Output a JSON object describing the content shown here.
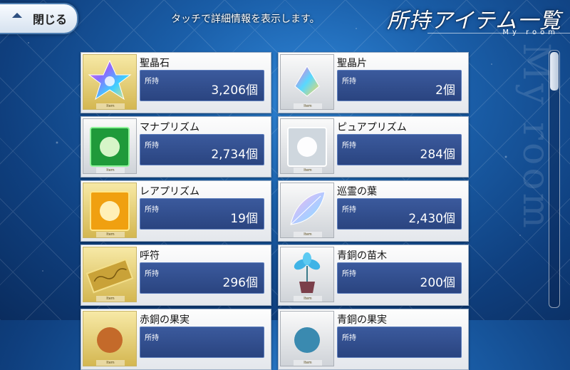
{
  "header": {
    "close_label": "閉じる",
    "hint": "タッチで詳細情報を表示します。",
    "title": "所持アイテム一覧",
    "subtitle": "My room"
  },
  "side_text": "My room",
  "owned_label": "所持",
  "item_tag": "Item",
  "items": [
    {
      "name": "聖晶石",
      "count": "3,206個",
      "icon": "saint-quartz-icon",
      "frame": "gold"
    },
    {
      "name": "聖晶片",
      "count": "2個",
      "icon": "quartz-fragment-icon",
      "frame": "silver"
    },
    {
      "name": "マナプリズム",
      "count": "2,734個",
      "icon": "mana-prism-icon",
      "frame": "silver"
    },
    {
      "name": "ピュアプリズム",
      "count": "284個",
      "icon": "pure-prism-icon",
      "frame": "silver"
    },
    {
      "name": "レアプリズム",
      "count": "19個",
      "icon": "rare-prism-icon",
      "frame": "gold"
    },
    {
      "name": "巡霊の葉",
      "count": "2,430個",
      "icon": "spirit-leaf-icon",
      "frame": "silver"
    },
    {
      "name": "呼符",
      "count": "296個",
      "icon": "summon-ticket-icon",
      "frame": "gold"
    },
    {
      "name": "青銅の苗木",
      "count": "200個",
      "icon": "bronze-sapling-icon",
      "frame": "silver"
    },
    {
      "name": "赤銅の果実",
      "count": "",
      "icon": "copper-fruit-icon",
      "frame": "gold"
    },
    {
      "name": "青銅の果実",
      "count": "",
      "icon": "bronze-fruit-icon",
      "frame": "silver"
    }
  ],
  "colors": {
    "background": "#1a5ea8",
    "count_box": "#2f4c8e",
    "gold_frame": "#d4b751"
  }
}
